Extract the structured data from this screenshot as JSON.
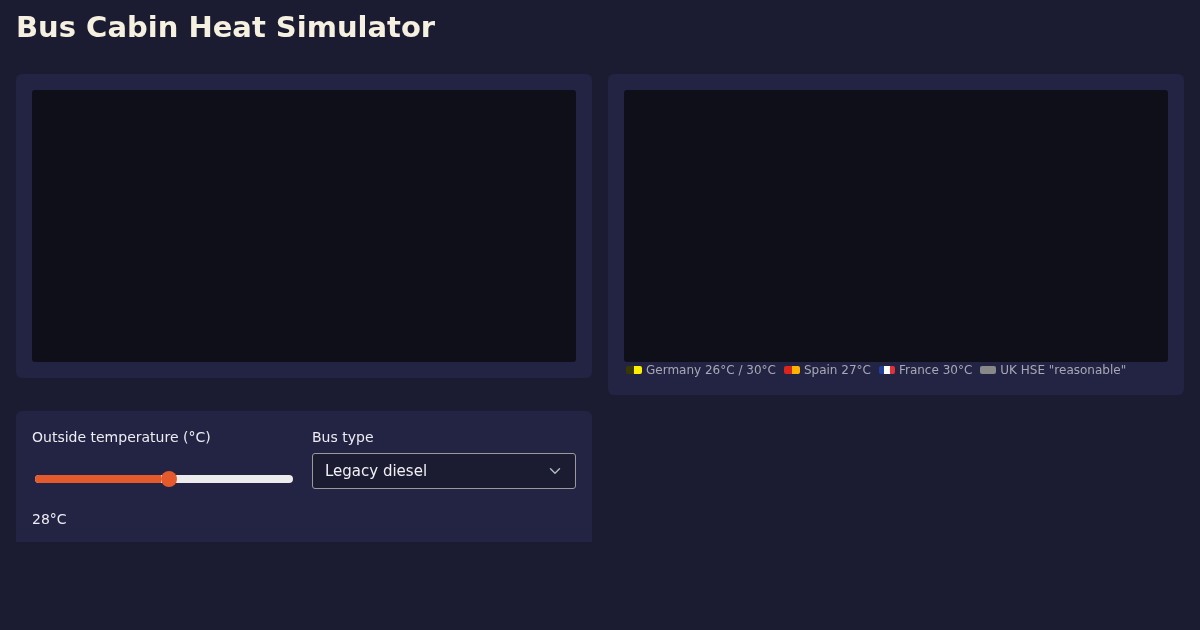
{
  "title": "Bus Cabin Heat Simulator",
  "legend": [
    {
      "label": "Germany 26°C / 30°C",
      "stops": [
        {
          "color": "#3a3a00"
        },
        {
          "color": "#ffee00"
        }
      ]
    },
    {
      "label": "Spain 27°C",
      "stops": [
        {
          "color": "#d9261c"
        },
        {
          "color": "#ffb300"
        }
      ]
    },
    {
      "label": "France 30°C",
      "stops": [
        {
          "color": "#1f3f9a"
        },
        {
          "color": "#ffffff"
        },
        {
          "color": "#e0303a"
        }
      ]
    },
    {
      "label": "UK HSE \"reasonable\"",
      "stops": [
        {
          "color": "#888888"
        }
      ]
    }
  ],
  "controls": {
    "temperature": {
      "label": "Outside temperature (°C)",
      "level": 0.52,
      "reading": "28°C"
    },
    "bus_type": {
      "label": "Bus type",
      "value": "Legacy diesel"
    }
  }
}
